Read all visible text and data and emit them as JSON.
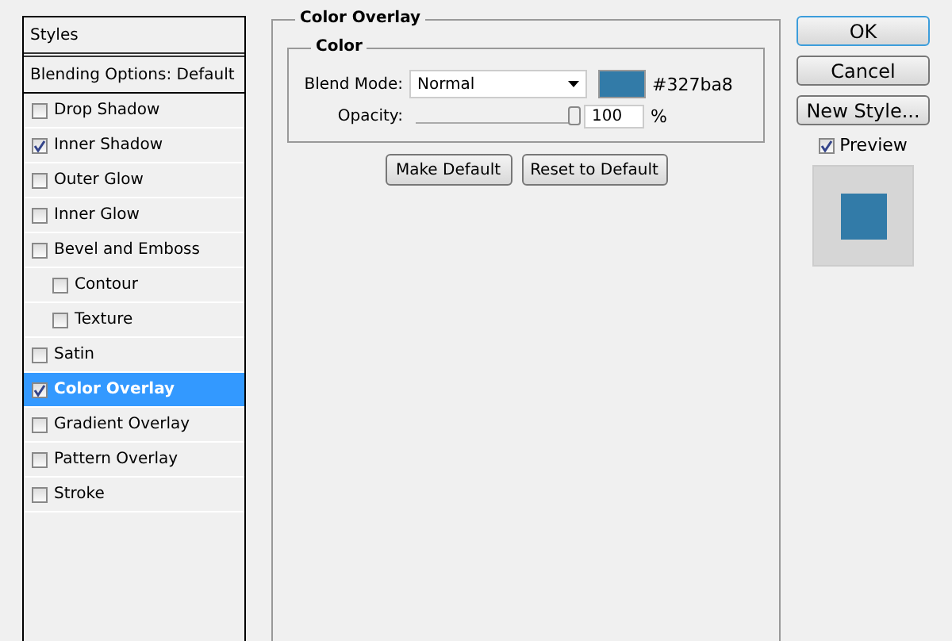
{
  "styles_panel": {
    "header": "Styles",
    "blending_options": "Blending Options: Default",
    "items": [
      {
        "label": "Drop Shadow",
        "checked": false,
        "selected": false
      },
      {
        "label": "Inner Shadow",
        "checked": true,
        "selected": false
      },
      {
        "label": "Outer Glow",
        "checked": false,
        "selected": false
      },
      {
        "label": "Inner Glow",
        "checked": false,
        "selected": false
      },
      {
        "label": "Bevel and Emboss",
        "checked": false,
        "selected": false,
        "children": [
          {
            "label": "Contour",
            "checked": false,
            "selected": false
          },
          {
            "label": "Texture",
            "checked": false,
            "selected": false
          }
        ]
      },
      {
        "label": "Satin",
        "checked": false,
        "selected": false
      },
      {
        "label": "Color Overlay",
        "checked": true,
        "selected": true
      },
      {
        "label": "Gradient Overlay",
        "checked": false,
        "selected": false
      },
      {
        "label": "Pattern Overlay",
        "checked": false,
        "selected": false
      },
      {
        "label": "Stroke",
        "checked": false,
        "selected": false
      }
    ]
  },
  "color_overlay": {
    "title": "Color Overlay",
    "group": "Color",
    "blend_mode_label": "Blend Mode:",
    "blend_mode": "Normal",
    "color": "#327ba8",
    "hex": "#327ba8",
    "opacity_label": "Opacity:",
    "opacity": {
      "level": 1
    },
    "opacity_value": "100",
    "opacity_unit": "%",
    "buttons": [
      "Make Default",
      "Reset to Default"
    ]
  },
  "actions": [
    {
      "label": "OK",
      "default": true
    },
    {
      "label": "Cancel",
      "default": false
    },
    {
      "label": "New Style...",
      "default": false
    }
  ],
  "preview": {
    "label": "Preview",
    "checked": true
  }
}
